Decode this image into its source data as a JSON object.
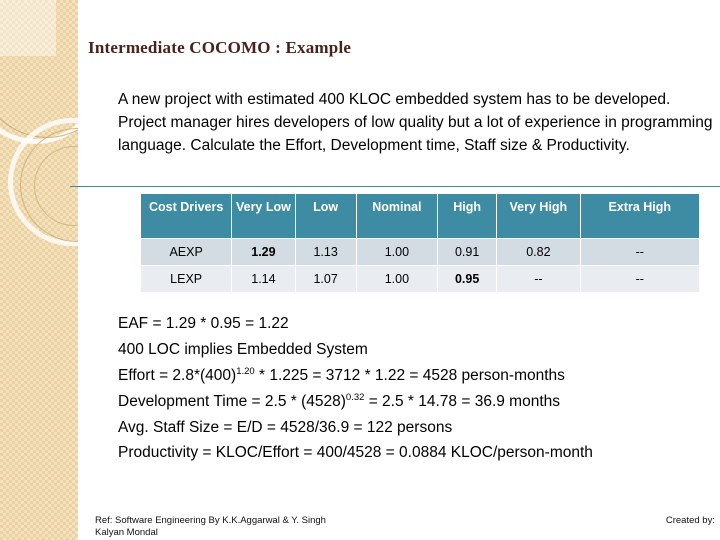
{
  "slide": {
    "title": "Intermediate COCOMO : Example",
    "intro": "A new project with estimated 400 KLOC embedded system has to be developed. Project manager hires developers of low quality but a lot of  experience in programming language. Calculate the Effort, Development time, Staff size & Productivity."
  },
  "table": {
    "headers": [
      "Cost Drivers",
      "Very Low",
      "Low",
      "Nominal",
      "High",
      "Very High",
      "Extra High"
    ],
    "rows": [
      {
        "label": "AEXP",
        "cells": [
          {
            "value": "1.29",
            "bold": true
          },
          {
            "value": "1.13",
            "bold": false
          },
          {
            "value": "1.00",
            "bold": false
          },
          {
            "value": "0.91",
            "bold": false
          },
          {
            "value": "0.82",
            "bold": false
          },
          {
            "value": "--",
            "bold": false
          }
        ]
      },
      {
        "label": "LEXP",
        "cells": [
          {
            "value": "1.14",
            "bold": false
          },
          {
            "value": "1.07",
            "bold": false
          },
          {
            "value": "1.00",
            "bold": false
          },
          {
            "value": "0.95",
            "bold": true
          },
          {
            "value": "--",
            "bold": false
          },
          {
            "value": "--",
            "bold": false
          }
        ]
      }
    ]
  },
  "calculations": {
    "eaf": "EAF = 1.29 * 0.95 = 1.22",
    "loc_note": "400 LOC implies Embedded System",
    "effort_pre": "Effort = 2.8*(400)",
    "effort_exp": "1.20",
    "effort_post": " * 1.225 = 3712 * 1.22 = 4528 person-months",
    "devtime_pre": "Development Time = 2.5 * (4528)",
    "devtime_exp": "0.32",
    "devtime_post": " = 2.5 * 14.78 = 36.9 months",
    "staff_size": "Avg. Staff Size = E/D = 4528/36.9 = 122 persons",
    "productivity": "Productivity = KLOC/Effort = 400/4528 = 0.0884 KLOC/person-month"
  },
  "footer": {
    "reference": "Ref: Software Engineering By K.K.Aggarwal & Y. Singh",
    "author": "Kalyan Mondal",
    "created_by": "Created by:"
  },
  "colors": {
    "header_teal": "#3d8ca3",
    "rule_teal": "#3f8ca1",
    "title_maroon": "#48231c",
    "row_shade": "#d2dce2",
    "row_light": "#e9edf1",
    "band_beige": "#f3e2bd"
  }
}
